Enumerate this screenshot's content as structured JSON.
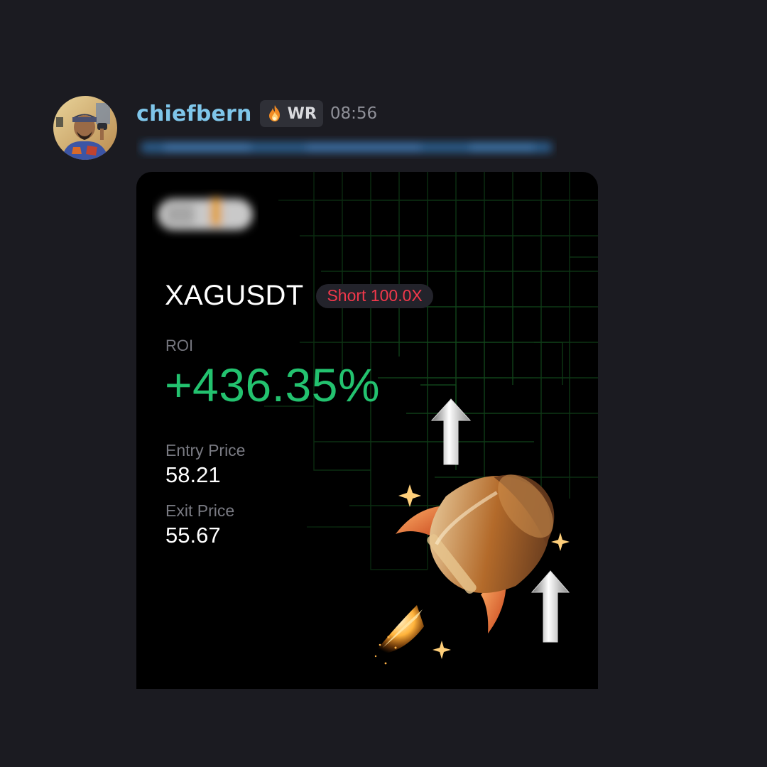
{
  "message": {
    "username": "chiefbern",
    "user_tag": "WR",
    "tag_icon": "flame-icon",
    "timestamp": "08:56",
    "link_text": "",
    "colors": {
      "background": "#1b1b21",
      "username": "#7fc6ea",
      "timestamp": "#8f9098",
      "link": "#2b5b8a"
    }
  },
  "trade_card": {
    "pair": "XAGUSDT",
    "side_leverage": "Short 100.0X",
    "roi_label": "ROI",
    "roi_value": "+436.35%",
    "entry_label": "Entry Price",
    "entry_value": "58.21",
    "exit_label": "Exit Price",
    "exit_value": "55.67",
    "colors": {
      "card_bg": "#000000",
      "roi": "#23c26f",
      "short": "#f2384b",
      "grid": "#0f3a16"
    },
    "illustration": "rocket-with-up-arrows"
  }
}
